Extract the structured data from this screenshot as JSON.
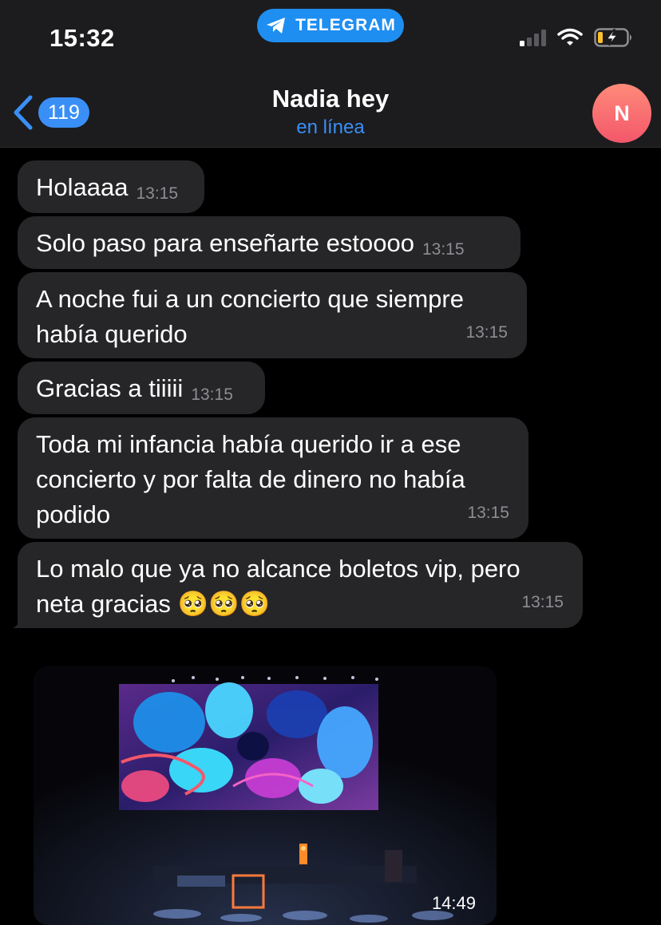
{
  "status_bar": {
    "time": "15:32",
    "app_pill": "TELEGRAM"
  },
  "header": {
    "back_count": "119",
    "title": "Nadia hey",
    "subtitle": "en línea",
    "avatar_letter": "N"
  },
  "messages": [
    {
      "text": "Holaaaa",
      "time": "13:15"
    },
    {
      "text": "Solo paso para enseñarte estoooo",
      "time": "13:15"
    },
    {
      "text": "A noche fui a un concierto que siempre había querido",
      "time": "13:15"
    },
    {
      "text": "Gracias a tiiiii",
      "time": "13:15"
    },
    {
      "text": "Toda mi infancia había querido ir a ese concierto y por falta de dinero no había podido",
      "time": "13:15"
    },
    {
      "text": "Lo malo que ya no alcance boletos vip, pero neta gracias 🥺🥺🥺",
      "time": "13:15"
    }
  ],
  "photo": {
    "time": "14:49"
  },
  "colors": {
    "accent": "#3a8ff6",
    "bubble": "#262628",
    "header": "#1c1c1e",
    "telegram": "#1f8ef1"
  },
  "icons": [
    "telegram-icon",
    "signal-icon",
    "wifi-icon",
    "battery-charging-icon",
    "back-chevron-icon",
    "emoji-pleading-face-icon"
  ]
}
